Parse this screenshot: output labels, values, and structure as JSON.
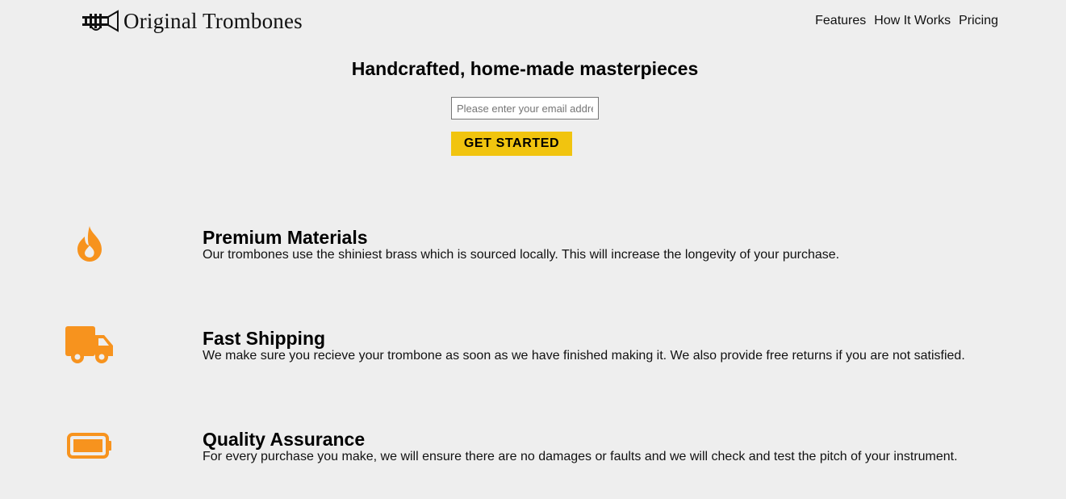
{
  "header": {
    "brand_name": "Original Trombones",
    "logo_icon": "trombone-icon",
    "nav": [
      {
        "label": "Features"
      },
      {
        "label": "How It Works"
      },
      {
        "label": "Pricing"
      }
    ]
  },
  "hero": {
    "title": "Handcrafted, home-made masterpieces",
    "email_placeholder": "Please enter your email address",
    "cta_label": "GET STARTED"
  },
  "features": [
    {
      "icon": "flame-icon",
      "title": "Premium Materials",
      "description": "Our trombones use the shiniest brass which is sourced locally. This will increase the longevity of your purchase."
    },
    {
      "icon": "truck-icon",
      "title": "Fast Shipping",
      "description": "We make sure you recieve your trombone as soon as we have finished making it. We also provide free returns if you are not satisfied."
    },
    {
      "icon": "battery-icon",
      "title": "Quality Assurance",
      "description": "For every purchase you make, we will ensure there are no damages or faults and we will check and test the pitch of your instrument."
    }
  ],
  "colors": {
    "background": "#eeeeee",
    "accent_orange": "#f7931e",
    "cta_yellow": "#f1c40f"
  }
}
